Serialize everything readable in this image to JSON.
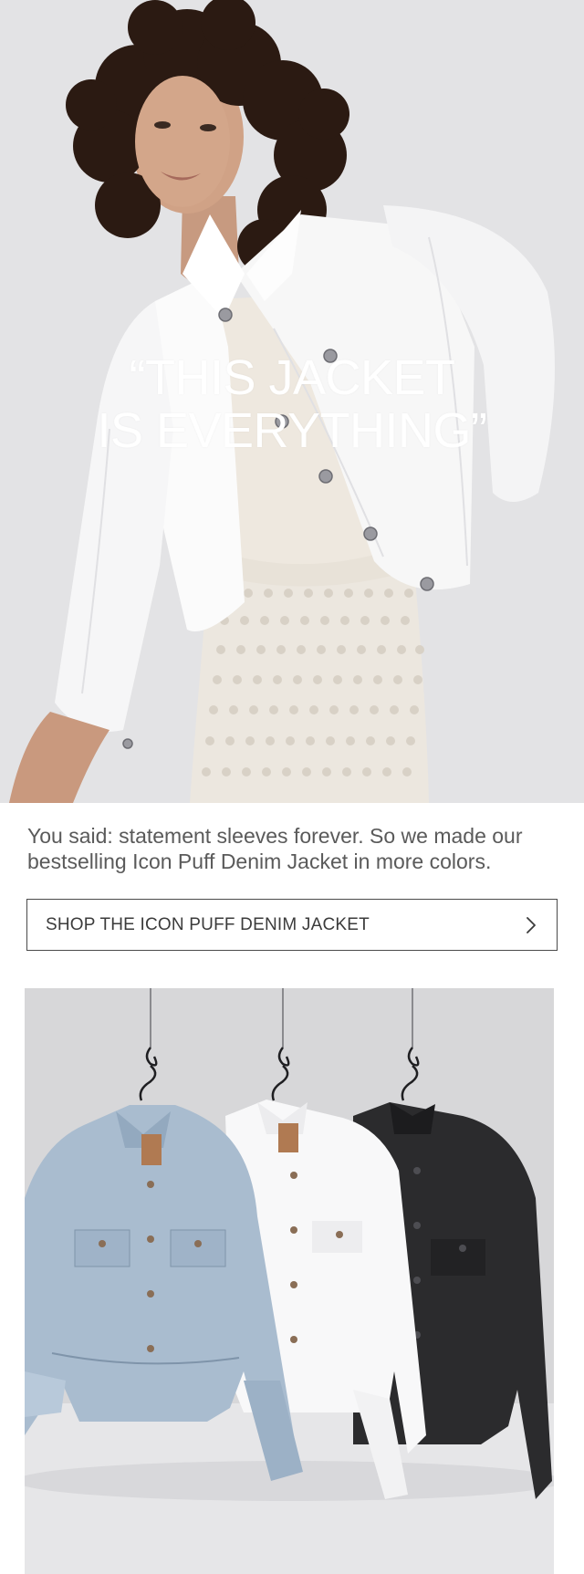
{
  "hero": {
    "quote_line1": "“THIS JACKET",
    "quote_line2": "IS EVERYTHING”",
    "image_alt": "Model wearing white puff-sleeve denim jacket"
  },
  "body": {
    "text": "You said: statement sleeves forever. So we made our bestselling Icon Puff Denim Jacket in more colors."
  },
  "cta": {
    "label": "SHOP THE ICON PUFF DENIM JACKET",
    "icon": "chevron-right-icon"
  },
  "product_image": {
    "alt": "Icon Puff Denim Jacket in light wash, white and black on hangers",
    "colors": [
      "#a9bccf",
      "#f6f6f6",
      "#2b2b2d"
    ]
  }
}
